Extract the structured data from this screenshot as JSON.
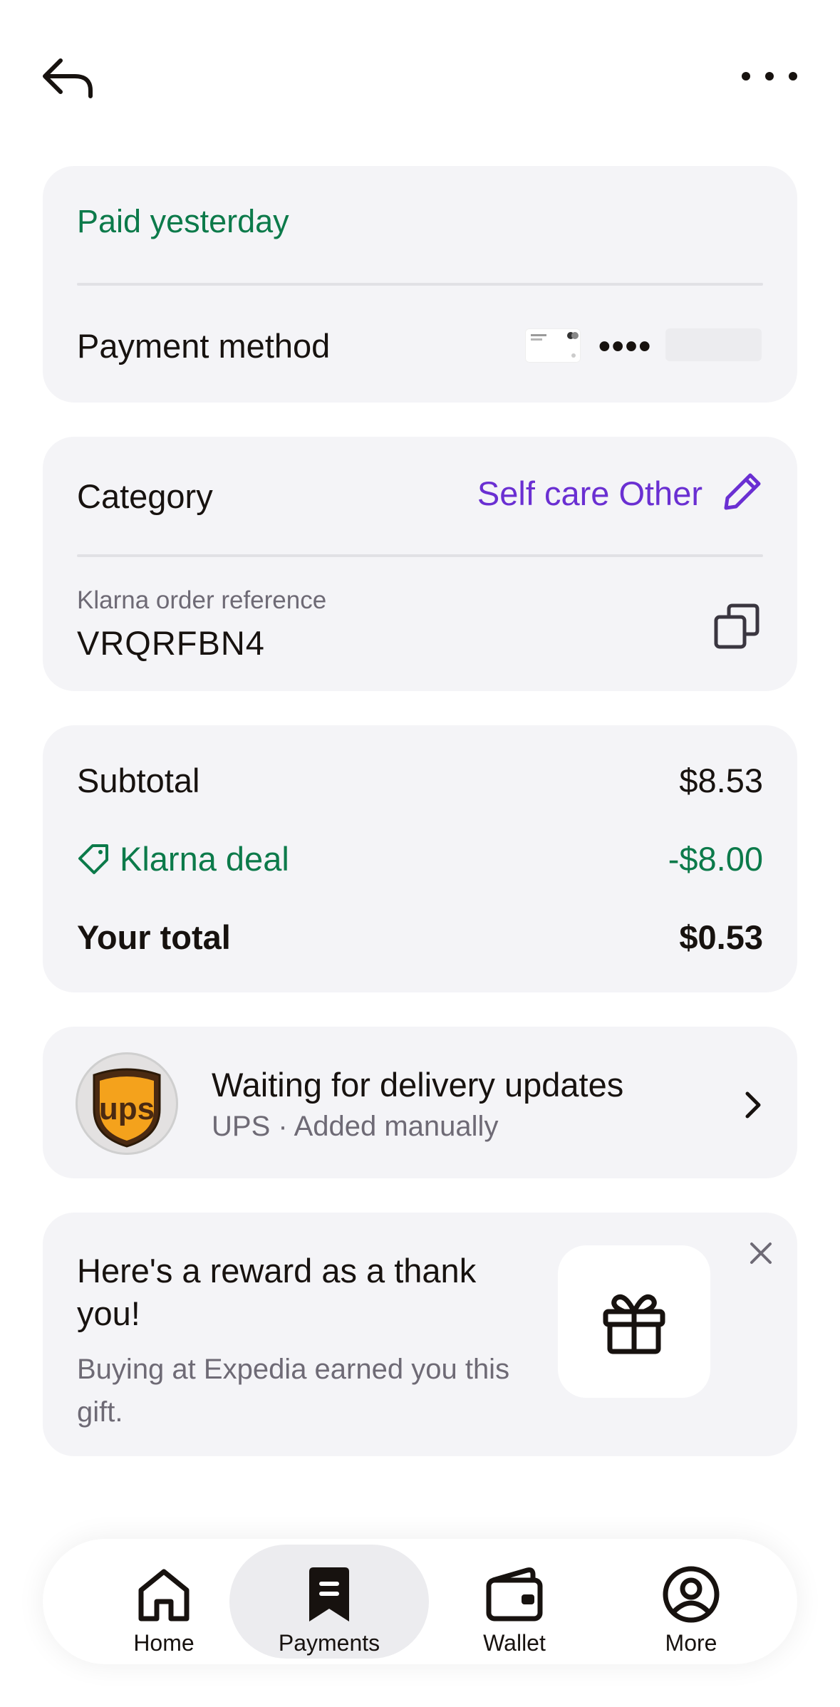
{
  "payment_status": "Paid yesterday",
  "payment_method": {
    "label": "Payment method",
    "masked_dots": "••••"
  },
  "category": {
    "label": "Category",
    "value": "Self care Other"
  },
  "order_reference": {
    "label": "Klarna order reference",
    "value": "VRQRFBN4"
  },
  "summary": {
    "subtotal_label": "Subtotal",
    "subtotal_value": "$8.53",
    "deal_label": "Klarna deal",
    "deal_value": "-$8.00",
    "total_label": "Your total",
    "total_value": "$0.53"
  },
  "delivery": {
    "carrier_logo_text": "ups",
    "title": "Waiting for delivery updates",
    "subtitle": "UPS · Added manually"
  },
  "reward": {
    "title": "Here's a reward as a thank you!",
    "subtitle": "Buying at Expedia earned you this gift."
  },
  "nav": {
    "items": [
      {
        "label": "Home",
        "icon": "home-icon"
      },
      {
        "label": "Payments",
        "icon": "receipt-icon",
        "active": true
      },
      {
        "label": "Wallet",
        "icon": "wallet-icon"
      },
      {
        "label": "More",
        "icon": "profile-icon"
      }
    ]
  },
  "colors": {
    "accent_purple": "#6a2fd2",
    "success_green": "#0c7a4a",
    "card_bg": "#f4f4f7",
    "text": "#17120f"
  }
}
